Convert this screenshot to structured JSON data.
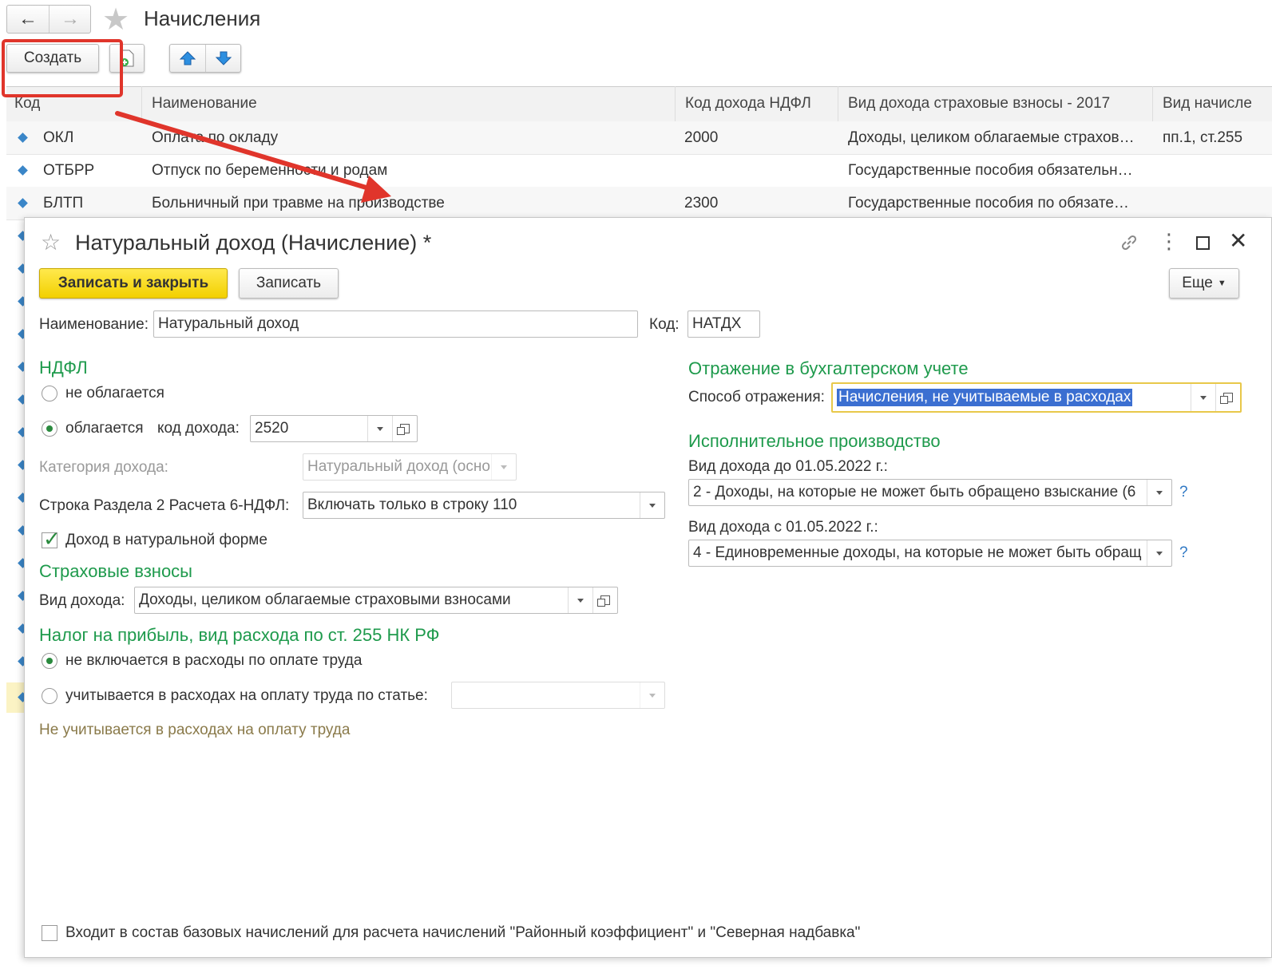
{
  "list": {
    "title": "Начисления",
    "create_label": "Создать",
    "columns": [
      "Код",
      "Наименование",
      "Код дохода НДФЛ",
      "Вид дохода страховые взносы - 2017",
      "Вид начисле"
    ],
    "rows": [
      {
        "code": "ОКЛ",
        "name": "Оплата по окладу",
        "ndfl": "2000",
        "insurance": "Доходы, целиком облагаемые страхов…",
        "type": "пп.1, ст.255"
      },
      {
        "code": "ОТБРР",
        "name": "Отпуск по беременности и родам",
        "ndfl": "",
        "insurance": "Государственные пособия обязательн…",
        "type": ""
      },
      {
        "code": "БЛТП",
        "name": "Больничный при травме на производстве",
        "ndfl": "2300",
        "insurance": "Государственные пособия по обязате…",
        "type": ""
      }
    ]
  },
  "dialog": {
    "title": "Натуральный доход (Начисление) *",
    "save_close_label": "Записать и закрыть",
    "save_label": "Записать",
    "more_label": "Еще",
    "name_label": "Наименование:",
    "name_value": "Натуральный доход",
    "code_label": "Код:",
    "code_value": "НАТДХ",
    "ndfl": {
      "heading": "НДФЛ",
      "not_taxed": "не облагается",
      "taxed": "облагается",
      "income_code_label": "код дохода:",
      "income_code_value": "2520",
      "category_label": "Категория дохода:",
      "category_value": "Натуральный доход (осно",
      "row_label": "Строка Раздела 2 Расчета 6-НДФЛ:",
      "row_value": "Включать только в строку 110",
      "natural_form_label": "Доход в натуральной форме"
    },
    "insurance": {
      "heading": "Страховые взносы",
      "type_label": "Вид дохода:",
      "type_value": "Доходы, целиком облагаемые страховыми взносами"
    },
    "profit_tax": {
      "heading": "Налог на прибыль, вид расхода по ст. 255 НК РФ",
      "not_included": "не включается в расходы по оплате труда",
      "included": "учитывается в расходах на оплату труда по статье:",
      "note": "Не учитывается в расходах на оплату труда"
    },
    "accounting": {
      "heading": "Отражение в бухгалтерском учете",
      "method_label": "Способ отражения:",
      "method_value": "Начисления, не учитываемые в расходах"
    },
    "enforcement": {
      "heading": "Исполнительное производство",
      "before_label": "Вид дохода до 01.05.2022 г.:",
      "before_value": "2 - Доходы, на которые не может быть обращено взыскание (6",
      "after_label": "Вид дохода с 01.05.2022 г.:",
      "after_value": "4 - Единовременные доходы, на которые не может быть обращ",
      "help": "?"
    },
    "base_charges_label": "Входит в состав базовых начислений для расчета начислений \"Районный коэффициент\" и \"Северная надбавка\""
  },
  "colors": {
    "accent_green": "#1e9a4c",
    "primary_button": "#f5d800",
    "annotation_red": "#e0352b",
    "selection_blue": "#3b6fd1"
  }
}
